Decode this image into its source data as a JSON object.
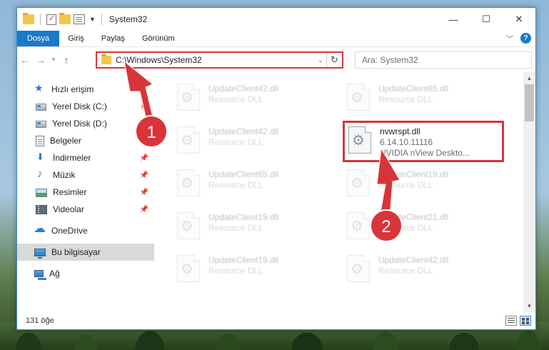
{
  "window": {
    "title": "System32",
    "controls": {
      "minimize": "—",
      "maximize": "☐",
      "close": "✕"
    }
  },
  "ribbon": {
    "tabs": [
      {
        "label": "Dosya",
        "active": true
      },
      {
        "label": "Giriş",
        "active": false
      },
      {
        "label": "Paylaş",
        "active": false
      },
      {
        "label": "Görünüm",
        "active": false
      }
    ],
    "help": "?"
  },
  "nav": {
    "address": "C:\\Windows\\System32",
    "search_placeholder": "Ara: System32"
  },
  "sidebar": {
    "quick_access": "Hızlı erişim",
    "items": [
      {
        "label": "Yerel Disk (C:)",
        "icon": "disk-icon",
        "pinned": true
      },
      {
        "label": "Yerel Disk (D:)",
        "icon": "disk-icon",
        "pinned": false
      },
      {
        "label": "Belgeler",
        "icon": "document-icon",
        "pinned": false
      },
      {
        "label": "İndirmeler",
        "icon": "download-icon",
        "pinned": true
      },
      {
        "label": "Müzik",
        "icon": "music-icon",
        "pinned": true
      },
      {
        "label": "Resimler",
        "icon": "pictures-icon",
        "pinned": true
      },
      {
        "label": "Videolar",
        "icon": "video-icon",
        "pinned": true
      }
    ],
    "onedrive": "OneDrive",
    "this_pc": "Bu bilgisayar",
    "network": "Ağ"
  },
  "files": [
    {
      "name": "UpdateClient42.dll",
      "sub": "Resource DLL",
      "blurred": true
    },
    {
      "name": "UpdateClient65.dll",
      "sub": "Resource DLL",
      "blurred": true
    },
    {
      "name": "UpdateClient42.dll",
      "sub": "Resource DLL",
      "blurred": true
    },
    {
      "name": "nvwrspt.dll",
      "sub": "6.14.10.11116",
      "desc": "NVIDIA nView Deskto...",
      "blurred": false
    },
    {
      "name": "UpdateClient65.dll",
      "sub": "Resource DLL",
      "blurred": true
    },
    {
      "name": "UpdateClient19.dll",
      "sub": "Resource DLL",
      "blurred": true
    },
    {
      "name": "UpdateClient19.dll",
      "sub": "Resource DLL",
      "blurred": true
    },
    {
      "name": "UpdateClient21.dll",
      "sub": "Resource DLL",
      "blurred": true
    },
    {
      "name": "UpdateClient19.dll",
      "sub": "Resource DLL",
      "blurred": true
    },
    {
      "name": "UpdateClient42.dll",
      "sub": "Resource DLL",
      "blurred": true
    }
  ],
  "status": {
    "count": "131 öğe"
  },
  "annotations": {
    "step1": "1",
    "step2": "2",
    "color": "#d8343a"
  }
}
